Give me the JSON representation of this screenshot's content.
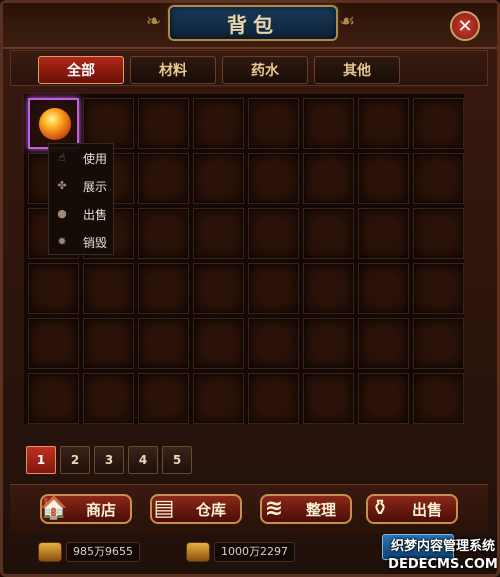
{
  "window": {
    "title": "背包",
    "close_icon": "close-icon"
  },
  "tabs": [
    {
      "label": "全部",
      "active": true
    },
    {
      "label": "材料",
      "active": false
    },
    {
      "label": "药水",
      "active": false
    },
    {
      "label": "其他",
      "active": false
    }
  ],
  "inventory": {
    "rows": 6,
    "cols": 8,
    "selected_item_icon": "orange-orb-icon"
  },
  "context_menu": {
    "items": [
      {
        "label": "使用",
        "icon": "hand-icon"
      },
      {
        "label": "展示",
        "icon": "show-icon"
      },
      {
        "label": "出售",
        "icon": "bag-icon"
      },
      {
        "label": "销毁",
        "icon": "destroy-icon"
      }
    ]
  },
  "pager": {
    "pages": [
      "1",
      "2",
      "3",
      "4",
      "5"
    ],
    "current": "1"
  },
  "actions": [
    {
      "label": "商店",
      "icon": "shop-icon"
    },
    {
      "label": "仓库",
      "icon": "warehouse-icon"
    },
    {
      "label": "整理",
      "icon": "scroll-icon"
    },
    {
      "label": "出售",
      "icon": "money-bag-icon"
    }
  ],
  "currency": {
    "gold": "985万9655",
    "bound_gold": "1000万2297"
  },
  "watermark": {
    "line1": "织梦内容管理系统",
    "line2": "DEDECMS.COM"
  },
  "colors": {
    "active_tab": "#b02818",
    "selected_slot": "#c060e0",
    "accent_gold": "#c89050"
  }
}
